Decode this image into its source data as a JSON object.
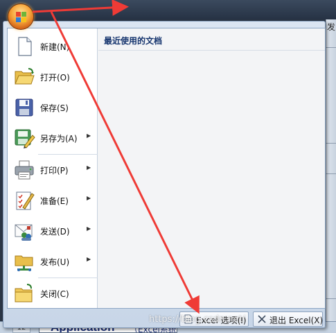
{
  "background": {
    "right_fragment_label": "发",
    "row_header": "12",
    "cell_title": "Application",
    "cell_subtitle": "（Excel系统）"
  },
  "menu": {
    "commands": [
      {
        "label": "新建(N)",
        "icon": "new-document-icon",
        "has_submenu": false
      },
      {
        "label": "打开(O)",
        "icon": "open-folder-icon",
        "has_submenu": false
      },
      {
        "label": "保存(S)",
        "icon": "save-disk-icon",
        "has_submenu": false
      },
      {
        "label": "另存为(A)",
        "icon": "save-as-icon",
        "has_submenu": true
      },
      {
        "label": "打印(P)",
        "icon": "printer-icon",
        "has_submenu": true
      },
      {
        "label": "准备(E)",
        "icon": "prepare-checklist-icon",
        "has_submenu": true
      },
      {
        "label": "发送(D)",
        "icon": "send-mail-icon",
        "has_submenu": true
      },
      {
        "label": "发布(U)",
        "icon": "publish-folder-icon",
        "has_submenu": true
      },
      {
        "label": "关闭(C)",
        "icon": "close-folder-icon",
        "has_submenu": false
      }
    ],
    "recent_title": "最近使用的文档",
    "options_button": "Excel 选项(I)",
    "exit_button": "退出 Excel(X)"
  },
  "watermark": "https://blog.csdn.net/",
  "colors": {
    "annotation_arrow": "#ef3b36",
    "recent_title": "#15346e",
    "menu_frame": "#c8d6e8"
  }
}
